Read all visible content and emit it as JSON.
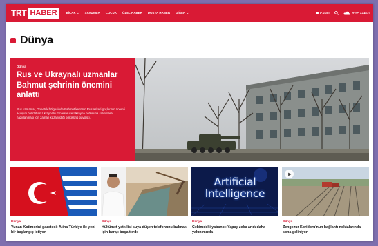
{
  "nav": {
    "logo_trt": "TRT",
    "logo_haber": "HABER",
    "menu": [
      {
        "label": "BİCAK ⌄"
      },
      {
        "label": "SAVUNMA"
      },
      {
        "label": "ÇOCUK"
      },
      {
        "label": "ÖZEL HABER"
      },
      {
        "label": "DOSYA HABER"
      },
      {
        "label": "DİĞER ⌄"
      }
    ],
    "live_label": "CANLI",
    "weather_text": "23°C Ankara"
  },
  "page": {
    "title": "Dünya"
  },
  "hero": {
    "category": "Dünya",
    "headline": "Rus ve Ukraynalı uzmanlar Bahmut şehrinin önemini anlattı",
    "summary": "Rus uzmanlar, Donetsk bölgesinde Bahmut kentinin Rus askeri güçlerinin önemli açılışını belirtirken Ukraynalı uzmanlar ise Ukrayna ordusuna saldırılara hazırlanması için zaman kazanıldığı görüşünü paylaştı."
  },
  "cards": [
    {
      "category": "Dünya",
      "title": "Yunan Kotimerini gazetesi: Atina Türkiye ile yeni bir başlangıç istiyor"
    },
    {
      "category": "Dünya",
      "title": "Hükümet yetkilisi suya düşen telefonunu bulmak için barajı boşalttırdı"
    },
    {
      "category": "Dünya",
      "title": "Cebimdeki yabancı: Yapay zeka artık daha yakınımızda",
      "image_text": "Artificial Intelligence"
    },
    {
      "category": "Dünya",
      "title": "Zengezur Koridoru'nun bağlantı noktalarında sona geliniyor"
    }
  ],
  "colors": {
    "brand_red": "#d91a35",
    "frame": "#7e6fae"
  }
}
